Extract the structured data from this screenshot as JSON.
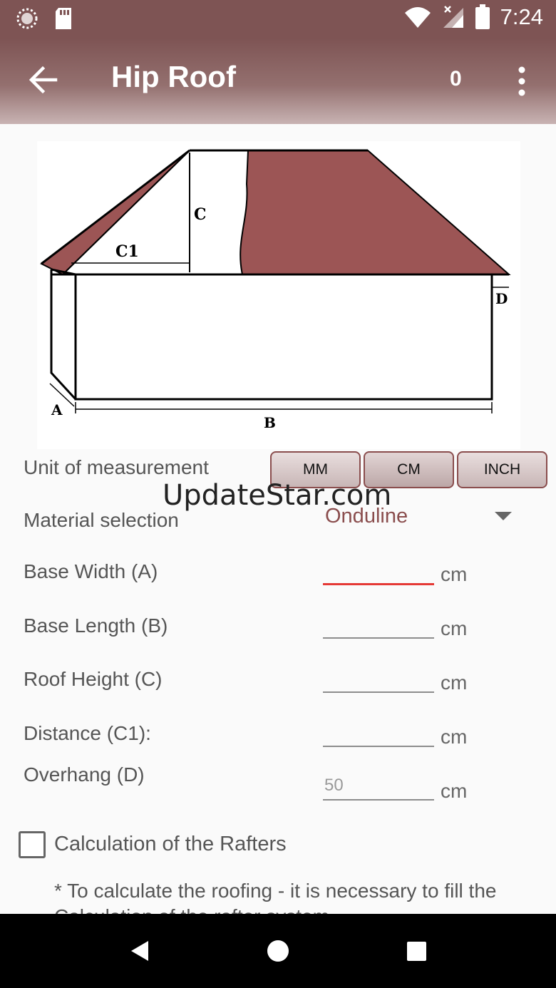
{
  "status_bar": {
    "time": "7:24",
    "icons": [
      "loading-circle-icon",
      "sd-card-icon",
      "wifi-icon",
      "signal-icon",
      "battery-icon"
    ]
  },
  "app_bar": {
    "title": "Hip Roof",
    "count": "0",
    "icons": [
      "back-arrow-icon",
      "more-vert-icon"
    ]
  },
  "diagram": {
    "labels": {
      "a": "A",
      "b": "B",
      "c": "C",
      "c1": "C1",
      "d": "D"
    },
    "roof_color": "#9c5555"
  },
  "unit": {
    "label": "Unit of measurement",
    "options": [
      "MM",
      "CM",
      "INCH"
    ],
    "selected": "CM"
  },
  "watermark": "UpdateStar.com",
  "material": {
    "label": "Material selection",
    "value": "Onduline"
  },
  "fields": [
    {
      "label": "Base Width (A)",
      "value": "",
      "placeholder": "",
      "unit": "cm"
    },
    {
      "label": "Base Length (B)",
      "value": "",
      "placeholder": "",
      "unit": "cm"
    },
    {
      "label": "Roof Height (C)",
      "value": "",
      "placeholder": "",
      "unit": "cm"
    },
    {
      "label": "Distance (C1):",
      "value": "",
      "placeholder": "",
      "unit": "cm"
    },
    {
      "label": "Overhang (D)",
      "value": "",
      "placeholder": "50",
      "unit": "cm"
    }
  ],
  "rafters": {
    "label": "Calculation of the Rafters",
    "checked": false
  },
  "note": "* To calculate the roofing - it is necessary to fill the Calculation of the rafter system",
  "colors": {
    "accent": "#8a4d4d",
    "app_bar": "#7e5454",
    "focus_underline": "#e53935"
  }
}
